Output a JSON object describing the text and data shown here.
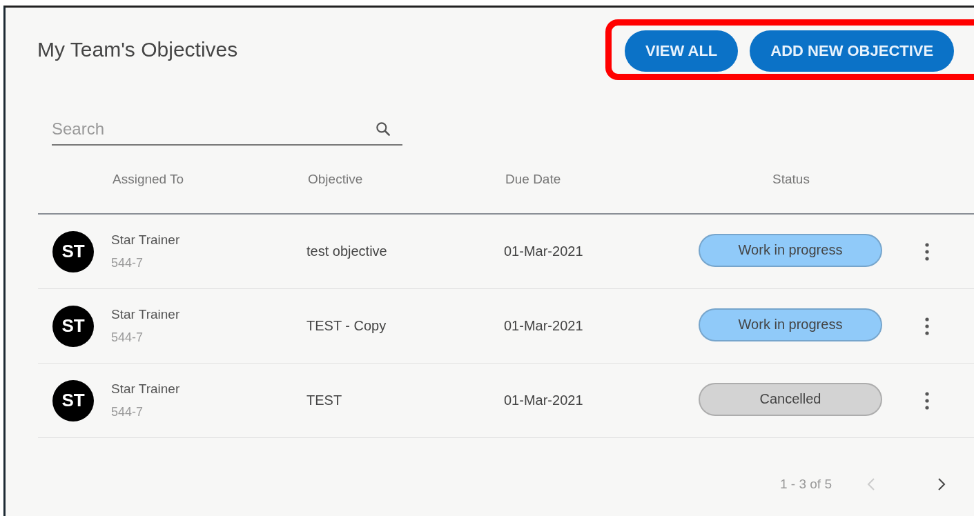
{
  "title": "My Team's Objectives",
  "actions": [
    {
      "label": "VIEW ALL"
    },
    {
      "label": "ADD NEW OBJECTIVE"
    }
  ],
  "search": {
    "placeholder": "Search"
  },
  "table": {
    "columns": [
      "Assigned To",
      "Objective",
      "Due Date",
      "Status"
    ],
    "rows": [
      {
        "initials": "ST",
        "name": "Star Trainer",
        "id": "544-7",
        "objective": "test objective",
        "due": "01-Mar-2021",
        "status": "Work in progress",
        "color": "#90caf9"
      },
      {
        "initials": "ST",
        "name": "Star Trainer",
        "id": "544-7",
        "objective": "TEST - Copy",
        "due": "01-Mar-2021",
        "status": "Work in progress",
        "color": "#90caf9"
      },
      {
        "initials": "ST",
        "name": "Star Trainer",
        "id": "544-7",
        "objective": "TEST",
        "due": "01-Mar-2021",
        "status": "Cancelled",
        "color": "#d3d3d3"
      }
    ]
  },
  "pagination": {
    "range": "1 - 3 of 5",
    "prev_disabled": true,
    "next_disabled": false
  }
}
